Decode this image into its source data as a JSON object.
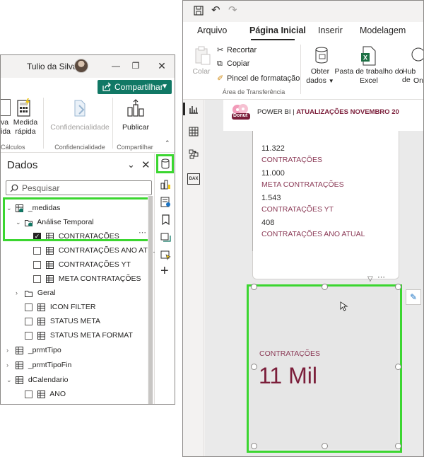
{
  "left": {
    "user_name": "Tulio da Silva",
    "share_label": "Compartilhar",
    "ribbon": {
      "partial_label_1": "va",
      "partial_label_2": "ida",
      "medida_rapida_line1": "Medida",
      "medida_rapida_line2": "rápida",
      "confidencialidade_btn": "Confidencialidade",
      "publicar": "Publicar",
      "group_calculos": "Cálculos",
      "group_confidencialidade": "Confidencialidade",
      "group_compartilhar": "Compartilhar"
    },
    "dados": {
      "title": "Dados",
      "search_placeholder": "Pesquisar",
      "tree": {
        "medidas": "_medidas",
        "analise_temporal": "Análise Temporal",
        "contratacoes": "CONTRATAÇÕES",
        "contratacoes_ano_atual": "CONTRATAÇÕES ANO ATU...",
        "contratacoes_yt": "CONTRATAÇÕES YT",
        "meta_contratacoes": "META CONTRATAÇÕES",
        "geral": "Geral",
        "icon_filter": "ICON FILTER",
        "status_meta": "STATUS META",
        "status_meta_format": "STATUS META FORMAT",
        "prmt_tipo": "_prmtTipo",
        "prmt_tipo_fin": "_prmtTipoFin",
        "dcalendario": "dCalendario",
        "ano": "ANO"
      }
    }
  },
  "right": {
    "tabs": [
      "Arquivo",
      "Página Inicial",
      "Inserir",
      "Modelagem"
    ],
    "ribbon": {
      "colar": "Colar",
      "recortar": "Recortar",
      "copiar": "Copiar",
      "pincel": "Pincel de formatação",
      "area_transferencia": "Área de Transferência",
      "obter_line1": "Obter",
      "obter_line2": "dados",
      "pasta_line1": "Pasta de trabalho do",
      "pasta_line2": "Excel",
      "hub_line1": "Hub de",
      "hub_line2": "One"
    },
    "report_header": {
      "logo_text": "Donut",
      "title_prefix": "POWER BI |",
      "title_highlight": "ATUALIZAÇÕES NOVEMBRO 20"
    },
    "list_card": [
      {
        "value": "11.322",
        "label": "CONTRATAÇÕES"
      },
      {
        "value": "11.000",
        "label": "META CONTRATAÇÕES"
      },
      {
        "value": "1.543",
        "label": "CONTRATAÇÕES YT"
      },
      {
        "value": "408",
        "label": "CONTRATAÇÕES ANO ATUAL"
      }
    ],
    "kpi": {
      "label": "CONTRATAÇÕES",
      "value": "11 Mil"
    }
  },
  "colors": {
    "accent_green": "#3bd630",
    "share_button": "#117865",
    "maroon": "#7b1e3a",
    "label_maroon": "#8b3a56"
  }
}
